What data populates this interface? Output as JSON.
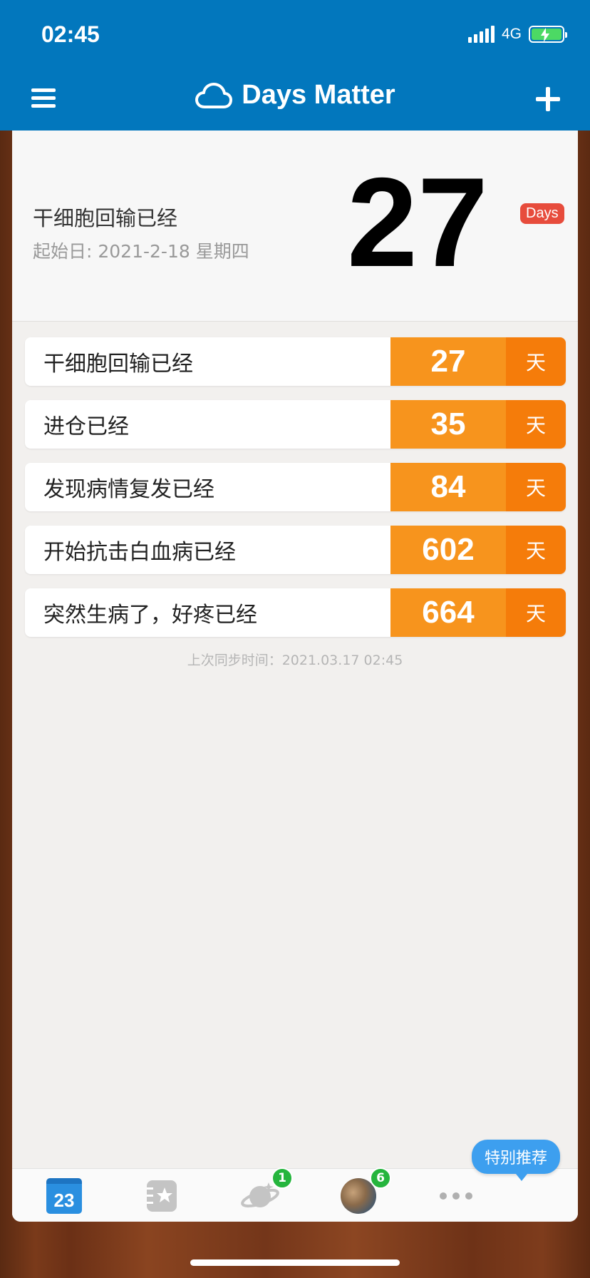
{
  "status": {
    "time": "02:45",
    "network": "4G"
  },
  "header": {
    "title": "Days Matter"
  },
  "hero": {
    "title": "干细胞回输已经",
    "subtitle": "起始日: 2021-2-18 星期四",
    "number": "27",
    "badge": "Days"
  },
  "events": [
    {
      "label": "干细胞回输已经",
      "days": "27",
      "unit": "天"
    },
    {
      "label": "进仓已经",
      "days": "35",
      "unit": "天"
    },
    {
      "label": "发现病情复发已经",
      "days": "84",
      "unit": "天"
    },
    {
      "label": "开始抗击白血病已经",
      "days": "602",
      "unit": "天"
    },
    {
      "label": "突然生病了，好疼已经",
      "days": "664",
      "unit": "天"
    }
  ],
  "sync_text": "上次同步时间：2021.03.17 02:45",
  "promo": "特别推荐",
  "tabbar": {
    "calendar_day": "23",
    "planet_badge": "1",
    "avatar_badge": "6",
    "icons": [
      "calendar-icon",
      "notebook-star-icon",
      "planet-icon",
      "avatar",
      "more-icon"
    ]
  },
  "colors": {
    "header": "#0277bd",
    "number_bg": "#f7941d",
    "unit_bg": "#f57c0a",
    "days_badge": "#e74c3c",
    "promo": "#3d9fef",
    "badge": "#25b53d"
  }
}
